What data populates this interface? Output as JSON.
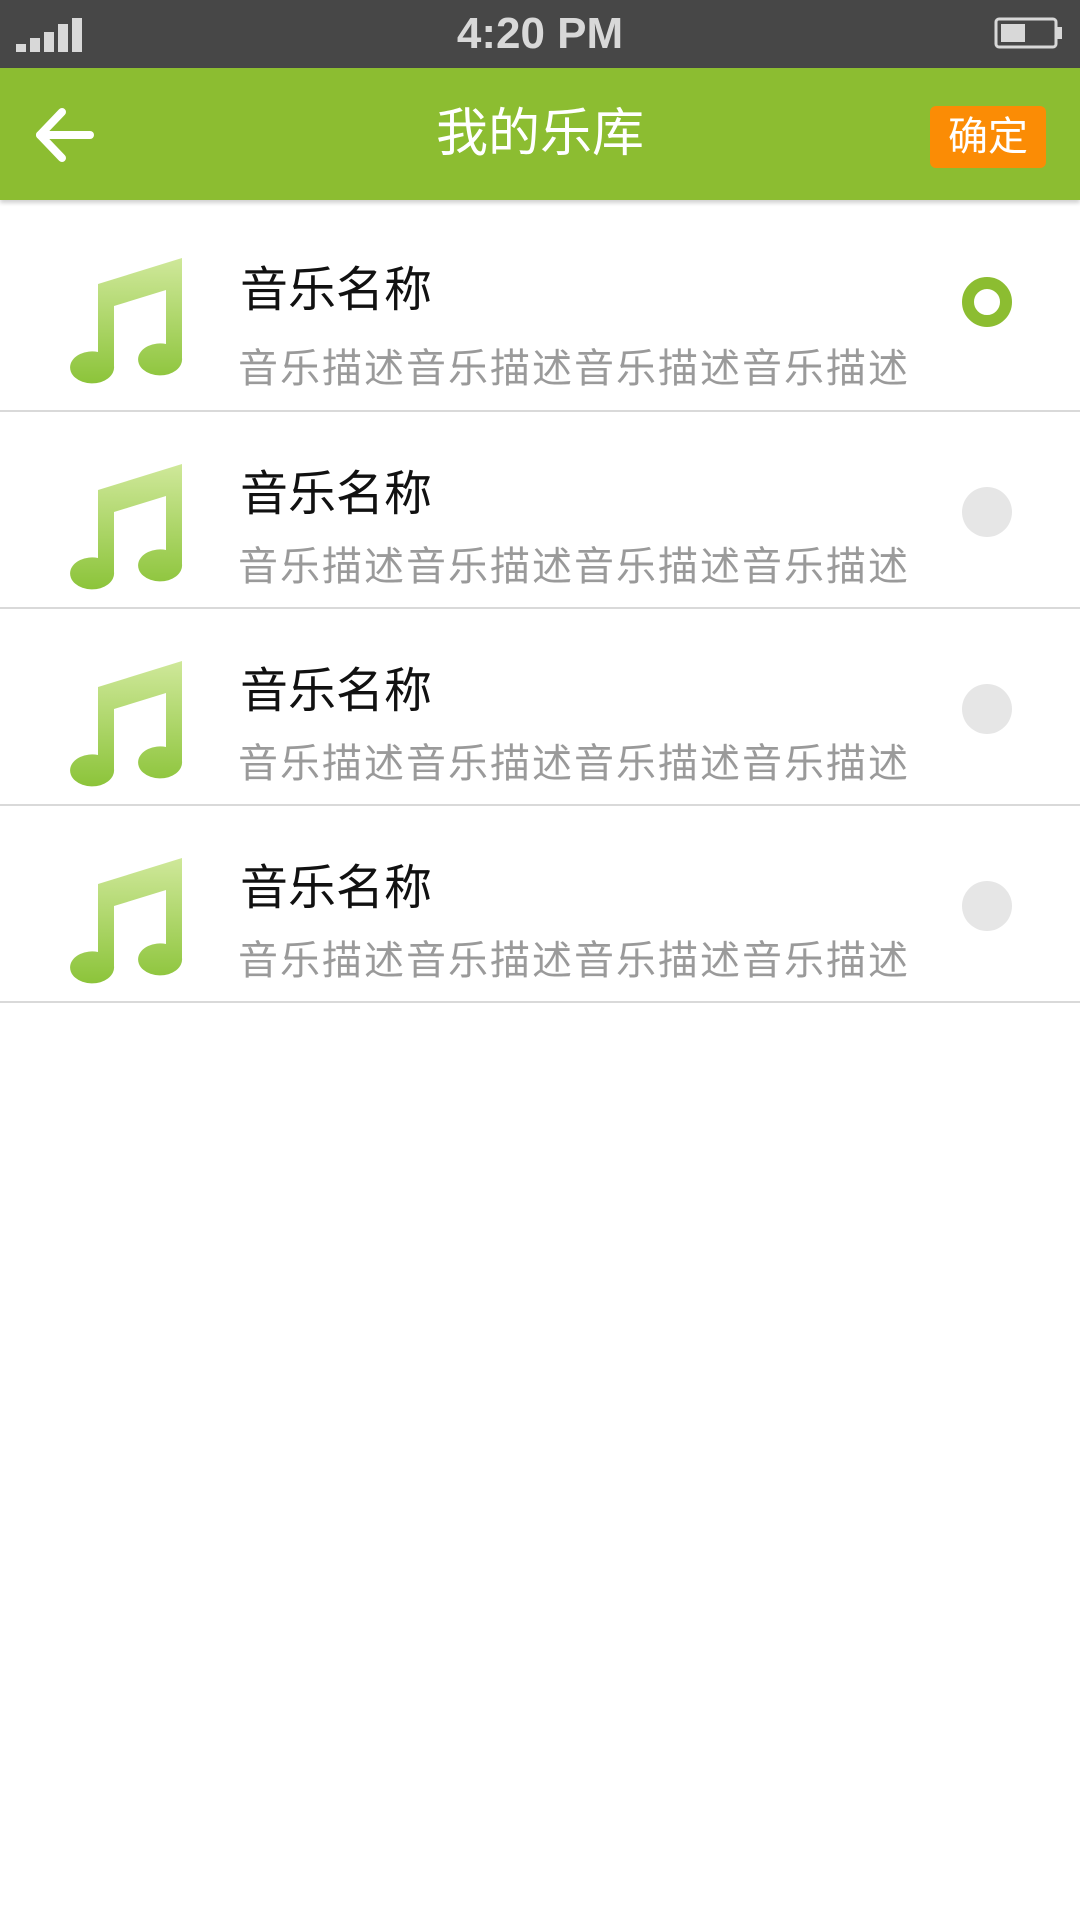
{
  "status_bar": {
    "time": "4:20 PM",
    "signal_icon": "signal-bars-icon",
    "battery_icon": "battery-icon"
  },
  "header": {
    "title": "我的乐库",
    "back_icon": "arrow-left-icon",
    "confirm_label": "确定",
    "background_color": "#8cbd31",
    "confirm_color": "#fb8c05"
  },
  "music_list": [
    {
      "title": "音乐名称",
      "description": "音乐描述音乐描述音乐描述音乐描述",
      "selected": true,
      "icon": "music-note-icon"
    },
    {
      "title": "音乐名称",
      "description": "音乐描述音乐描述音乐描述音乐描述",
      "selected": false,
      "icon": "music-note-icon"
    },
    {
      "title": "音乐名称",
      "description": "音乐描述音乐描述音乐描述音乐描述",
      "selected": false,
      "icon": "music-note-icon"
    },
    {
      "title": "音乐名称",
      "description": "音乐描述音乐描述音乐描述音乐描述",
      "selected": false,
      "icon": "music-note-icon"
    }
  ]
}
